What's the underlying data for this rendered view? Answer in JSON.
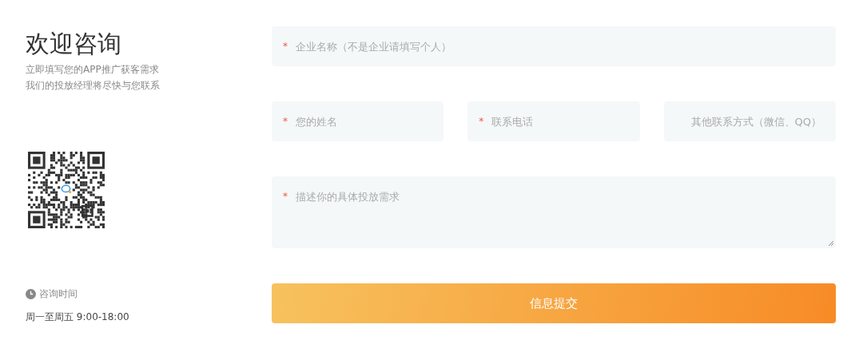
{
  "intro": {
    "title": "欢迎咨询",
    "lines": [
      "立即填写您的APP推广获客需求",
      "我们的投放经理将尽快与您联系"
    ]
  },
  "hours": {
    "label": "咨询时间",
    "value": "周一至周五 9:00-18:00"
  },
  "form": {
    "rows": [
      {
        "fields": [
          {
            "kind": "input",
            "mark": "*",
            "placeholder": "企业名称（不是企业请填写个人）"
          }
        ]
      },
      {
        "fields": [
          {
            "kind": "input",
            "mark": "*",
            "placeholder": "您的姓名"
          },
          {
            "kind": "input",
            "mark": "*",
            "placeholder": "联系电话"
          },
          {
            "kind": "centered-input",
            "placeholder": "其他联系方式（微信、QQ）"
          }
        ]
      },
      {
        "fields": [
          {
            "kind": "textarea",
            "mark": "*",
            "placeholder": "描述你的具体投放需求"
          }
        ]
      }
    ],
    "submit": "信息提交"
  }
}
